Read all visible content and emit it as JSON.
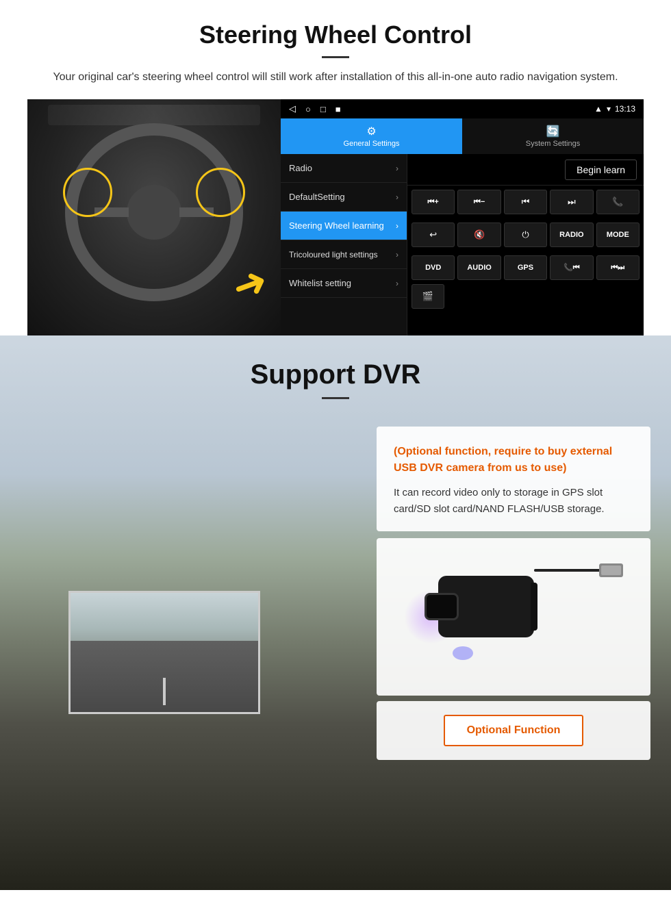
{
  "section1": {
    "title": "Steering Wheel Control",
    "subtitle": "Your original car's steering wheel control will still work after installation of this all-in-one auto radio navigation system.",
    "android": {
      "statusbar": {
        "time": "13:13",
        "nav_icons": [
          "◁",
          "○",
          "□",
          "■"
        ]
      },
      "tabs": [
        {
          "icon": "⚙",
          "label": "General Settings",
          "active": true
        },
        {
          "icon": "🔄",
          "label": "System Settings",
          "active": false
        }
      ],
      "menu_items": [
        {
          "label": "Radio",
          "active": false
        },
        {
          "label": "DefaultSetting",
          "active": false
        },
        {
          "label": "Steering Wheel learning",
          "active": true
        },
        {
          "label": "Tricoloured light settings",
          "active": false
        },
        {
          "label": "Whitelist setting",
          "active": false
        }
      ],
      "begin_learn_label": "Begin learn",
      "control_buttons": [
        [
          "⏮+",
          "⏮−",
          "⏮⏮",
          "⏭⏭",
          "📞"
        ],
        [
          "↩",
          "🔇",
          "⏻",
          "RADIO",
          "MODE"
        ],
        [
          "DVD",
          "AUDIO",
          "GPS",
          "📞⏮",
          "⏮⏭"
        ]
      ],
      "bottom_btn": "🎬"
    }
  },
  "section2": {
    "title": "Support DVR",
    "optional_note": "(Optional function, require to buy external USB DVR camera from us to use)",
    "description": "It can record video only to storage in GPS slot card/SD slot card/NAND FLASH/USB storage.",
    "optional_fn_label": "Optional Function"
  }
}
